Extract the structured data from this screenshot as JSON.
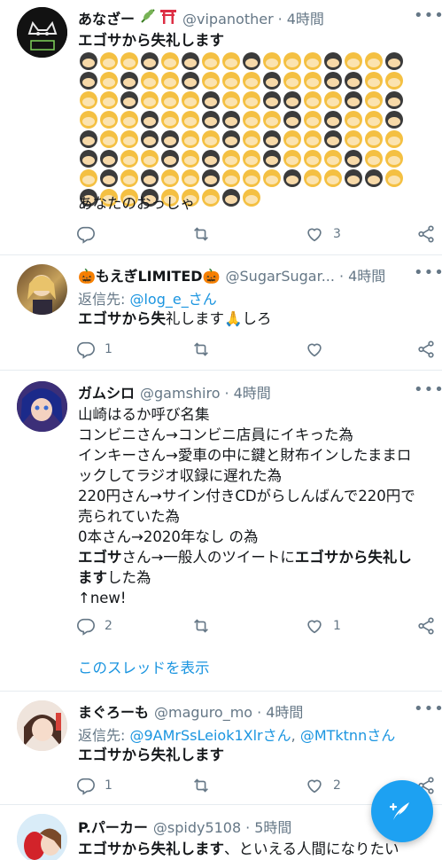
{
  "tweets": [
    {
      "name": "あなざー",
      "handle": "@vipanother",
      "time": "4時間",
      "headline": "エゴサから失礼します",
      "footer_text": "あなたのおっしゃ",
      "replies": "",
      "retweets": "",
      "likes": "3"
    },
    {
      "name": "🎃もえぎLIMITED🎃",
      "handle": "@SugarSugar...",
      "time": "4時間",
      "reply_prefix": "返信先: ",
      "reply_to": "@log_e_さん",
      "text_bold": "エゴサから失",
      "text_rest": "礼します🙏しろ",
      "replies": "1",
      "retweets": "",
      "likes": ""
    },
    {
      "name": "ガムシロ",
      "handle": "@gamshiro",
      "time": "4時間",
      "lines": [
        "山崎はるか呼び名集",
        "コンビニさん→コンビニ店員にイキった為",
        "インキーさん→愛車の中に鍵と財布インしたままロ",
        "ックしてラジオ収録に遅れた為",
        "220円さん→サイン付きCDがらしんばんで220円で",
        "売られていた為",
        "0本さん→2020年なし の為"
      ],
      "line8_bold1": "エゴサ",
      "line8_mid": "さん→一般人のツイートに",
      "line8_bold2": "エゴサから失礼し",
      "line9_bold": "ます",
      "line9_rest": "した為",
      "line10": "↑new!",
      "replies": "2",
      "retweets": "",
      "likes": "1",
      "show_thread": "このスレッドを表示"
    },
    {
      "name": "まぐろーも",
      "handle": "@maguro_mo",
      "time": "4時間",
      "reply_prefix": "返信先: ",
      "reply_to_1": "@9AMrSsLeiok1Xlrさん",
      "reply_sep": ", ",
      "reply_to_2": "@MTktnnさん",
      "text_bold": "エゴサから失礼します",
      "replies": "1",
      "retweets": "",
      "likes": "2"
    },
    {
      "name": "P.パーカー",
      "handle": "@spidy5108",
      "time": "5時間",
      "text_bold": "エゴサから失礼します",
      "text_rest": "、といえる人間になりたい"
    }
  ],
  "colors": {
    "accent": "#1da1f2",
    "link": "#1b95e0",
    "muted": "#657786",
    "text": "#14171a"
  },
  "icons": [
    "reply-icon",
    "retweet-icon",
    "like-icon",
    "share-icon",
    "more-icon",
    "compose-icon"
  ]
}
